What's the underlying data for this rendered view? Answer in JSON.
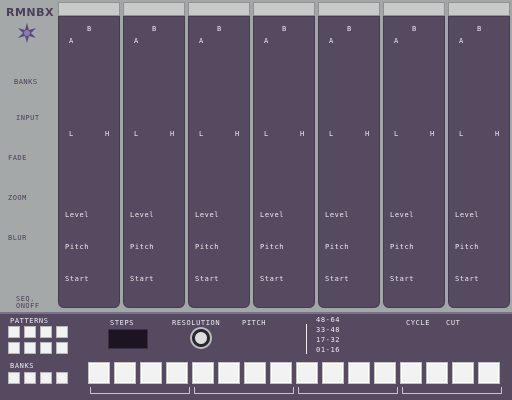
{
  "app": {
    "title": "RMNBX"
  },
  "left_labels": [
    "BANKS",
    "INPUT",
    "FADE",
    "ZOOM",
    "BLUR",
    "SEQ. ONOFF"
  ],
  "strip_labels": {
    "a": "A",
    "b": "B",
    "l": "L",
    "h": "H",
    "level": "Level",
    "pitch": "Pitch",
    "start": "Start"
  },
  "strip_count": 7,
  "bottom": {
    "patterns": "PATTERNS",
    "banks": "BANKS",
    "steps": "STEPS",
    "resolution": "RESOLUTION",
    "pitch": "PITCH",
    "ranges": [
      "48-64",
      "33-48",
      "17-32",
      "01-16"
    ],
    "cycle": "CYCLE",
    "cut": "CUT"
  },
  "colors": {
    "panel": "#554a60",
    "chrome": "#a4a8a8",
    "text_light": "#ece9f2",
    "text_dark": "#4b3f58"
  },
  "icons": {
    "logo": "purple-star-icon"
  }
}
